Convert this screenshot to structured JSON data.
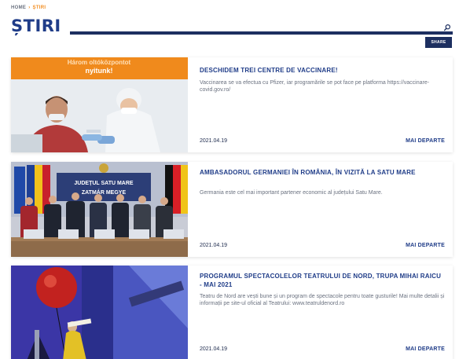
{
  "breadcrumb": {
    "home": "HOME",
    "separator": "›",
    "current": "ȘTIRI"
  },
  "page": {
    "title": "ȘTIRI"
  },
  "toolbar": {
    "share_label": "SHARE",
    "search_icon": "search-icon"
  },
  "colors": {
    "brand_navy": "#1d2f60",
    "title_blue": "#1f3c88",
    "accent_orange": "#f28c1e"
  },
  "articles": [
    {
      "title": "DESCHIDEM TREI CENTRE DE VACCINARE!",
      "excerpt": "Vaccinarea se va efectua cu Pfizer, iar programările se pot face pe platforma https://vaccinare-covid.gov.ro/",
      "date": "2021.04.19",
      "more": "MAI DEPARTE",
      "image_text": [
        "Három oltóközpontot",
        "nyitunk!"
      ]
    },
    {
      "title": "AMBASADORUL GERMANIEI ÎN ROMÂNIA, ÎN VIZITĂ LA SATU MARE",
      "excerpt": "Germania este cel mai important partener economic al județului Satu Mare.",
      "date": "2021.04.19",
      "more": "MAI DEPARTE",
      "image_text": [
        "JUDEȚUL SATU MARE",
        "ZATMÁR MEGYE"
      ]
    },
    {
      "title": "PROGRAMUL SPECTACOLELOR TEATRULUI DE NORD, TRUPA MIHAI RAICU - MAI 2021",
      "excerpt": "Teatru de Nord are vești bune și un program de spectacole pentru toate gusturile! Mai multe detalii și informații pe site-ul oficial al Teatrului: www.teatruldenord.ro",
      "date": "2021.04.19",
      "more": "MAI DEPARTE",
      "image_text": []
    }
  ]
}
